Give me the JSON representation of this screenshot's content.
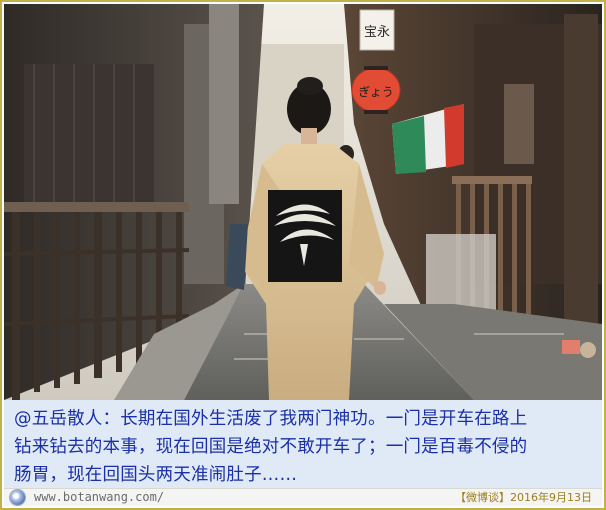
{
  "caption": {
    "line1": "@五岳散人：长期在国外生活废了我两门神功。一门是开车在路上",
    "line2": "钻来钻去的本事，现在回国是绝对不敢开车了；一门是百毒不侵的",
    "line3": "肠胃，现在回国头两天准闹肚子……"
  },
  "footer": {
    "site_url": "www.botanwang.com/",
    "source": "【微博谈】2016年9月13日"
  },
  "photo": {
    "sign_text": "宝永",
    "lantern_text": "ぎょう"
  },
  "colors": {
    "frame": "#c3b04a",
    "caption_bg": "#dfeaf6",
    "caption_text": "#1a2fa8",
    "source_text": "#9c7e1d"
  }
}
